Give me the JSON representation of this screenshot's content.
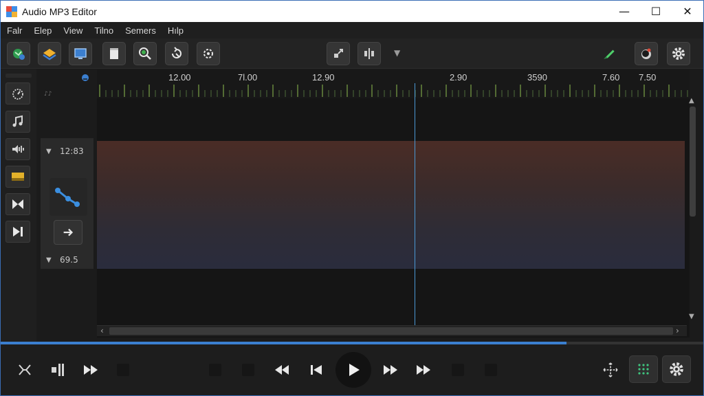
{
  "window": {
    "title": "Audio MP3 Editor",
    "controls": [
      "—",
      "☐",
      "✕"
    ]
  },
  "menu": [
    "Falr",
    "Elep",
    "View",
    "Tilno",
    "Semers",
    "Hılp"
  ],
  "ruler": {
    "labels": [
      "12.00",
      "7l.00",
      "12.90",
      "2.90",
      "3590",
      "7.60",
      "7.50"
    ]
  },
  "track": {
    "top_label": "12:83",
    "bottom_label": "69.5"
  },
  "progress": {
    "fraction": 0.805
  },
  "colors": {
    "accent": "#3b7fd0",
    "wave_green": "#7fcf5a",
    "wave_yellow": "#c8c24a",
    "playhead": "#4b9ad6"
  }
}
